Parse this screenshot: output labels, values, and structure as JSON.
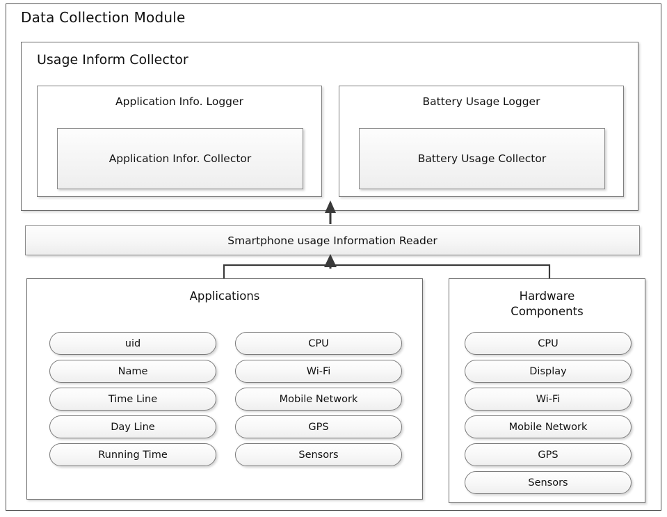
{
  "module": {
    "title": "Data Collection Module"
  },
  "usage_collector": {
    "title": "Usage Inform Collector",
    "loggers": [
      {
        "title": "Application Info. Logger",
        "collector": "Application Infor. Collector"
      },
      {
        "title": "Battery Usage Logger",
        "collector": "Battery Usage Collector"
      }
    ]
  },
  "reader": {
    "label": "Smartphone usage Information Reader"
  },
  "applications": {
    "title": "Applications",
    "column_a": [
      "uid",
      "Name",
      "Time Line",
      "Day Line",
      "Running Time"
    ],
    "column_b": [
      "CPU",
      "Wi-Fi",
      "Mobile Network",
      "GPS",
      "Sensors"
    ]
  },
  "hardware": {
    "title_line1": "Hardware",
    "title_line2": "Components",
    "items": [
      "CPU",
      "Display",
      "Wi-Fi",
      "Mobile Network",
      "GPS",
      "Sensors"
    ]
  },
  "connectors": {
    "reader_to_collector": "arrow-up",
    "sources_to_reader": "merge-arrow-up"
  },
  "colors": {
    "background": "#ffffff",
    "text": "#111111",
    "border": "#6b6b6b",
    "fill_gradient_top": "#fdfdfd",
    "fill_gradient_bottom": "#eeeeee",
    "connector": "#3a3a3a"
  }
}
